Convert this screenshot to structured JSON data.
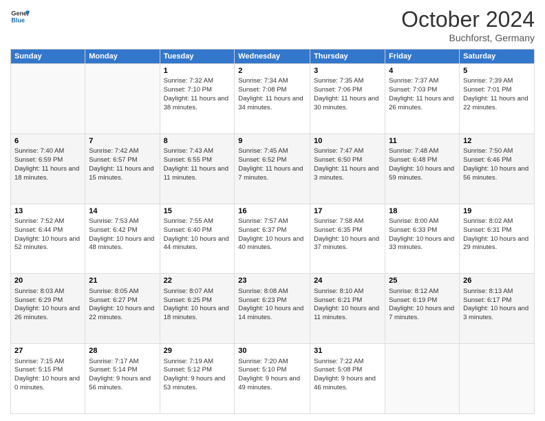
{
  "header": {
    "logo_line1": "General",
    "logo_line2": "Blue",
    "month": "October 2024",
    "location": "Buchforst, Germany"
  },
  "weekdays": [
    "Sunday",
    "Monday",
    "Tuesday",
    "Wednesday",
    "Thursday",
    "Friday",
    "Saturday"
  ],
  "weeks": [
    [
      {
        "day": "",
        "info": ""
      },
      {
        "day": "",
        "info": ""
      },
      {
        "day": "1",
        "info": "Sunrise: 7:32 AM\nSunset: 7:10 PM\nDaylight: 11 hours and 38 minutes."
      },
      {
        "day": "2",
        "info": "Sunrise: 7:34 AM\nSunset: 7:08 PM\nDaylight: 11 hours and 34 minutes."
      },
      {
        "day": "3",
        "info": "Sunrise: 7:35 AM\nSunset: 7:06 PM\nDaylight: 11 hours and 30 minutes."
      },
      {
        "day": "4",
        "info": "Sunrise: 7:37 AM\nSunset: 7:03 PM\nDaylight: 11 hours and 26 minutes."
      },
      {
        "day": "5",
        "info": "Sunrise: 7:39 AM\nSunset: 7:01 PM\nDaylight: 11 hours and 22 minutes."
      }
    ],
    [
      {
        "day": "6",
        "info": "Sunrise: 7:40 AM\nSunset: 6:59 PM\nDaylight: 11 hours and 18 minutes."
      },
      {
        "day": "7",
        "info": "Sunrise: 7:42 AM\nSunset: 6:57 PM\nDaylight: 11 hours and 15 minutes."
      },
      {
        "day": "8",
        "info": "Sunrise: 7:43 AM\nSunset: 6:55 PM\nDaylight: 11 hours and 11 minutes."
      },
      {
        "day": "9",
        "info": "Sunrise: 7:45 AM\nSunset: 6:52 PM\nDaylight: 11 hours and 7 minutes."
      },
      {
        "day": "10",
        "info": "Sunrise: 7:47 AM\nSunset: 6:50 PM\nDaylight: 11 hours and 3 minutes."
      },
      {
        "day": "11",
        "info": "Sunrise: 7:48 AM\nSunset: 6:48 PM\nDaylight: 10 hours and 59 minutes."
      },
      {
        "day": "12",
        "info": "Sunrise: 7:50 AM\nSunset: 6:46 PM\nDaylight: 10 hours and 56 minutes."
      }
    ],
    [
      {
        "day": "13",
        "info": "Sunrise: 7:52 AM\nSunset: 6:44 PM\nDaylight: 10 hours and 52 minutes."
      },
      {
        "day": "14",
        "info": "Sunrise: 7:53 AM\nSunset: 6:42 PM\nDaylight: 10 hours and 48 minutes."
      },
      {
        "day": "15",
        "info": "Sunrise: 7:55 AM\nSunset: 6:40 PM\nDaylight: 10 hours and 44 minutes."
      },
      {
        "day": "16",
        "info": "Sunrise: 7:57 AM\nSunset: 6:37 PM\nDaylight: 10 hours and 40 minutes."
      },
      {
        "day": "17",
        "info": "Sunrise: 7:58 AM\nSunset: 6:35 PM\nDaylight: 10 hours and 37 minutes."
      },
      {
        "day": "18",
        "info": "Sunrise: 8:00 AM\nSunset: 6:33 PM\nDaylight: 10 hours and 33 minutes."
      },
      {
        "day": "19",
        "info": "Sunrise: 8:02 AM\nSunset: 6:31 PM\nDaylight: 10 hours and 29 minutes."
      }
    ],
    [
      {
        "day": "20",
        "info": "Sunrise: 8:03 AM\nSunset: 6:29 PM\nDaylight: 10 hours and 26 minutes."
      },
      {
        "day": "21",
        "info": "Sunrise: 8:05 AM\nSunset: 6:27 PM\nDaylight: 10 hours and 22 minutes."
      },
      {
        "day": "22",
        "info": "Sunrise: 8:07 AM\nSunset: 6:25 PM\nDaylight: 10 hours and 18 minutes."
      },
      {
        "day": "23",
        "info": "Sunrise: 8:08 AM\nSunset: 6:23 PM\nDaylight: 10 hours and 14 minutes."
      },
      {
        "day": "24",
        "info": "Sunrise: 8:10 AM\nSunset: 6:21 PM\nDaylight: 10 hours and 11 minutes."
      },
      {
        "day": "25",
        "info": "Sunrise: 8:12 AM\nSunset: 6:19 PM\nDaylight: 10 hours and 7 minutes."
      },
      {
        "day": "26",
        "info": "Sunrise: 8:13 AM\nSunset: 6:17 PM\nDaylight: 10 hours and 3 minutes."
      }
    ],
    [
      {
        "day": "27",
        "info": "Sunrise: 7:15 AM\nSunset: 5:15 PM\nDaylight: 10 hours and 0 minutes."
      },
      {
        "day": "28",
        "info": "Sunrise: 7:17 AM\nSunset: 5:14 PM\nDaylight: 9 hours and 56 minutes."
      },
      {
        "day": "29",
        "info": "Sunrise: 7:19 AM\nSunset: 5:12 PM\nDaylight: 9 hours and 53 minutes."
      },
      {
        "day": "30",
        "info": "Sunrise: 7:20 AM\nSunset: 5:10 PM\nDaylight: 9 hours and 49 minutes."
      },
      {
        "day": "31",
        "info": "Sunrise: 7:22 AM\nSunset: 5:08 PM\nDaylight: 9 hours and 46 minutes."
      },
      {
        "day": "",
        "info": ""
      },
      {
        "day": "",
        "info": ""
      }
    ]
  ]
}
